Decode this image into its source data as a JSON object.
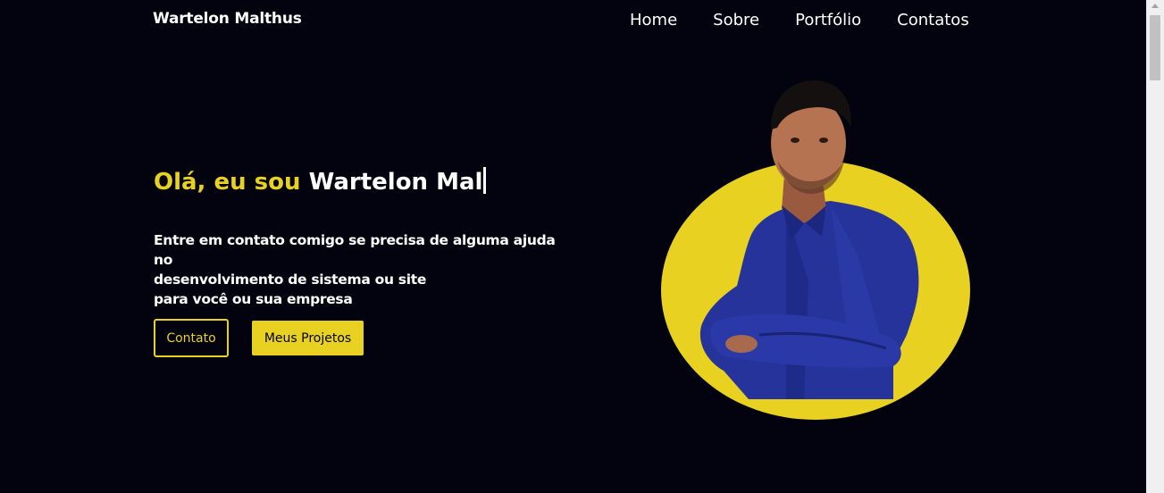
{
  "brand": "Wartelon Malthus",
  "nav": {
    "home": "Home",
    "sobre": "Sobre",
    "portfolio": "Portfólio",
    "contatos": "Contatos"
  },
  "hero": {
    "greeting": "Olá, eu sou",
    "typed_name": "Wartelon Mal",
    "description_lines": [
      "Entre em contato comigo se precisa de alguma ajuda no",
      "desenvolvimento de sistema ou site",
      "para você ou sua empresa"
    ],
    "contact_button": "Contato",
    "projects_button": "Meus Projetos"
  },
  "portrait": {
    "icon": "person-portrait-photo"
  },
  "colors": {
    "background": "#02030f",
    "accent": "#e8d120",
    "text": "#ffffff",
    "shirt": "#25339a"
  }
}
